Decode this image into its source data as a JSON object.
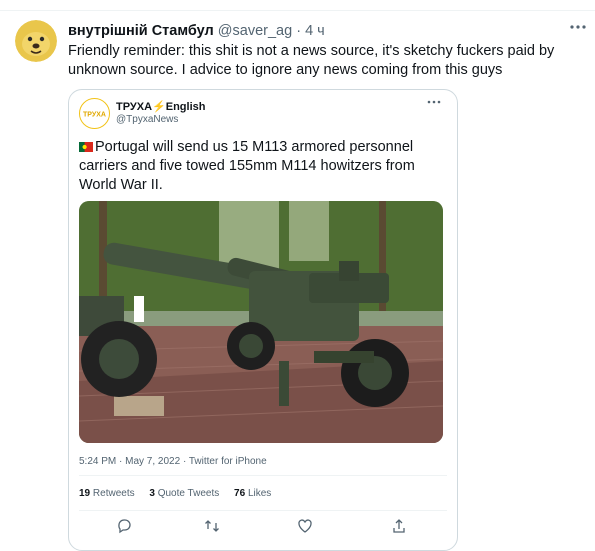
{
  "tweet": {
    "author_name": "внутрішній Стамбул",
    "handle": "@saver_ag",
    "separator": "·",
    "time": "4 ч",
    "text": "Friendly reminder: this shit is not a news source, it's sketchy fuckers paid by unknown source. I advice to ignore any news coming from this guys"
  },
  "quote": {
    "avatar_text": "ТРУХА",
    "name": "ТРУХА⚡English",
    "handle": "@TpyxaNews",
    "text": "Portugal will send us 15 M113 armored personnel carriers and five towed 155mm M114 howitzers from World War II.",
    "meta": "5:24 PM · May 7, 2022 · Twitter for iPhone",
    "retweets_count": "19",
    "retweets_label": "Retweets",
    "quote_count": "3",
    "quote_label": "Quote Tweets",
    "likes_count": "76",
    "likes_label": "Likes"
  },
  "icons": {
    "more": "more-icon",
    "reply": "reply-icon",
    "retweet": "retweet-icon",
    "like": "like-icon",
    "share": "share-icon"
  },
  "colors": {
    "text": "#0f1419",
    "secondary": "#536471",
    "border": "#cfd9de",
    "avatar_yellow": "#f2c318"
  }
}
